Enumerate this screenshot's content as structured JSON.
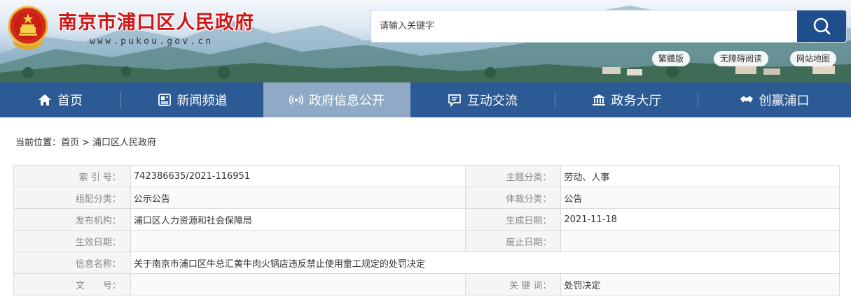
{
  "header": {
    "site_title": "南京市浦口区人民政府",
    "site_url": "www.pukou.gov.cn",
    "emblem_icon": "national-emblem-icon",
    "search": {
      "placeholder": "请输入关键字",
      "button_icon": "search-icon"
    },
    "quick_links": [
      "繁體版",
      "无障碍阅读",
      "网站地图"
    ]
  },
  "nav": {
    "items": [
      {
        "label": "首页",
        "icon": "home-icon"
      },
      {
        "label": "新闻频道",
        "icon": "news-icon"
      },
      {
        "label": "政府信息公开",
        "icon": "broadcast-icon",
        "active": true
      },
      {
        "label": "互动交流",
        "icon": "chat-icon"
      },
      {
        "label": "政务大厅",
        "icon": "hall-icon"
      },
      {
        "label": "创赢浦口",
        "icon": "handshake-icon"
      }
    ]
  },
  "breadcrumb": {
    "prefix": "当前位置：",
    "items": [
      "首页",
      "浦口区人民政府"
    ],
    "separator": ">"
  },
  "info": {
    "rows": [
      {
        "l1": "索 引 号：",
        "v1": "742386635/2021-116951",
        "l2": "主题分类：",
        "v2": "劳动、人事"
      },
      {
        "l1": "组配分类：",
        "v1": "公示公告",
        "l2": "体裁分类：",
        "v2": "公告"
      },
      {
        "l1": "发布机构：",
        "v1": "浦口区人力资源和社会保障局",
        "l2": "生成日期：",
        "v2": "2021-11-18"
      },
      {
        "l1": "生效日期：",
        "v1": "",
        "l2": "废止日期：",
        "v2": ""
      },
      {
        "l1": "信息名称：",
        "v1": "关于南京市浦口区牛总汇黄牛肉火锅店违反禁止使用童工规定的处罚决定"
      },
      {
        "l1": "文　　号：",
        "v1": "",
        "l2": "关 键 词：",
        "v2": "处罚决定"
      }
    ]
  },
  "colors": {
    "title_red": "#d01515",
    "nav_blue": "#2b5a94",
    "nav_active": "#8fa9c6",
    "search_button": "#1f4e8c"
  }
}
